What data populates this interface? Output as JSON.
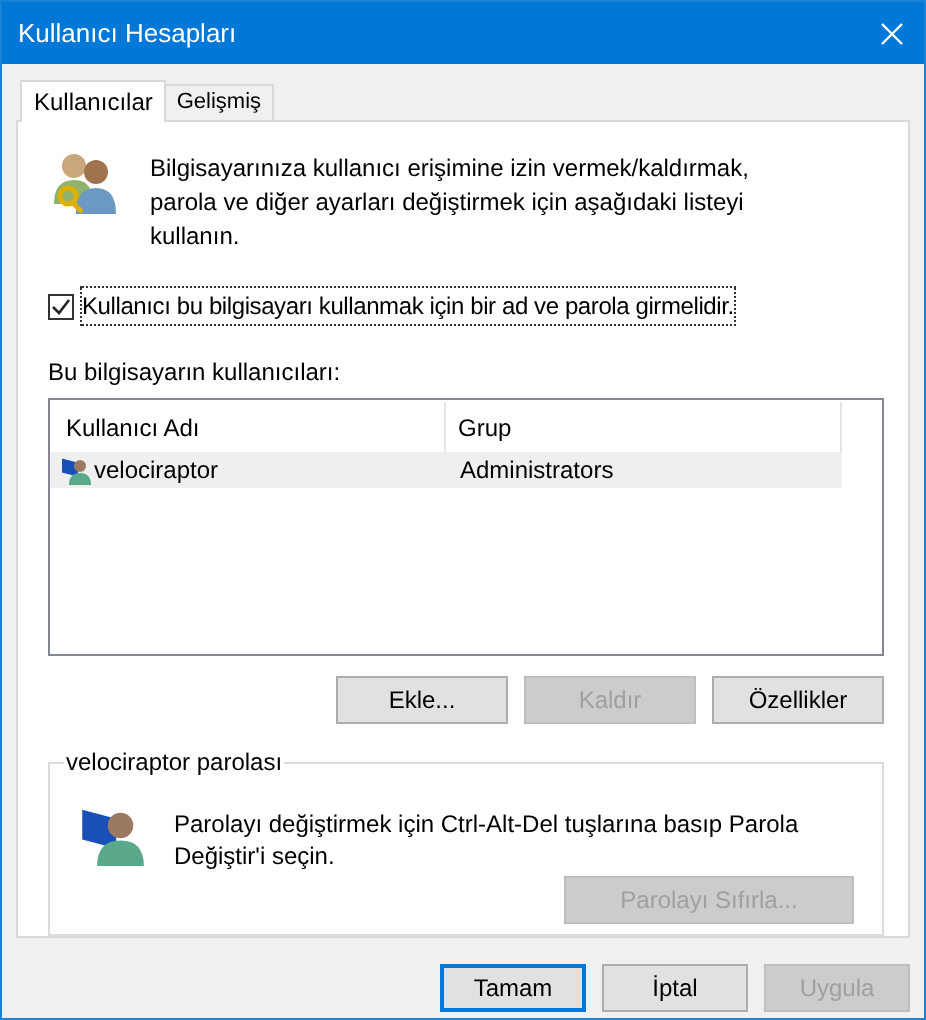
{
  "window": {
    "title": "Kullanıcı Hesapları"
  },
  "tabs": [
    {
      "label": "Kullanıcılar",
      "selected": true
    },
    {
      "label": "Gelişmiş",
      "selected": false
    }
  ],
  "intro": "Bilgisayarınıza kullanıcı erişimine izin vermek/kaldırmak, parola ve diğer ayarları değiştirmek için aşağıdaki listeyi kullanın.",
  "require_password": {
    "label": "Kullanıcı bu bilgisayarı kullanmak için bir ad ve parola girmelidir.",
    "checked": true
  },
  "users_label": "Bu bilgisayarın kullanıcıları:",
  "table": {
    "columns": [
      "Kullanıcı Adı",
      "Grup"
    ],
    "rows": [
      {
        "name": "velociraptor",
        "group": "Administrators",
        "selected": true
      }
    ]
  },
  "user_buttons": [
    {
      "label": "Ekle...",
      "disabled": false
    },
    {
      "label": "Kaldır",
      "disabled": true
    },
    {
      "label": "Özellikler",
      "disabled": false
    }
  ],
  "password_group": {
    "title": "velociraptor parolası",
    "text": "Parolayı değiştirmek için Ctrl-Alt-Del tuşlarına basıp Parola Değiştir'i seçin.",
    "button": {
      "label": "Parolayı Sıfırla...",
      "disabled": true
    }
  },
  "dialog_buttons": [
    {
      "label": "Tamam",
      "disabled": false,
      "default": true
    },
    {
      "label": "İptal",
      "disabled": false,
      "default": false
    },
    {
      "label": "Uygula",
      "disabled": true,
      "default": false
    }
  ]
}
